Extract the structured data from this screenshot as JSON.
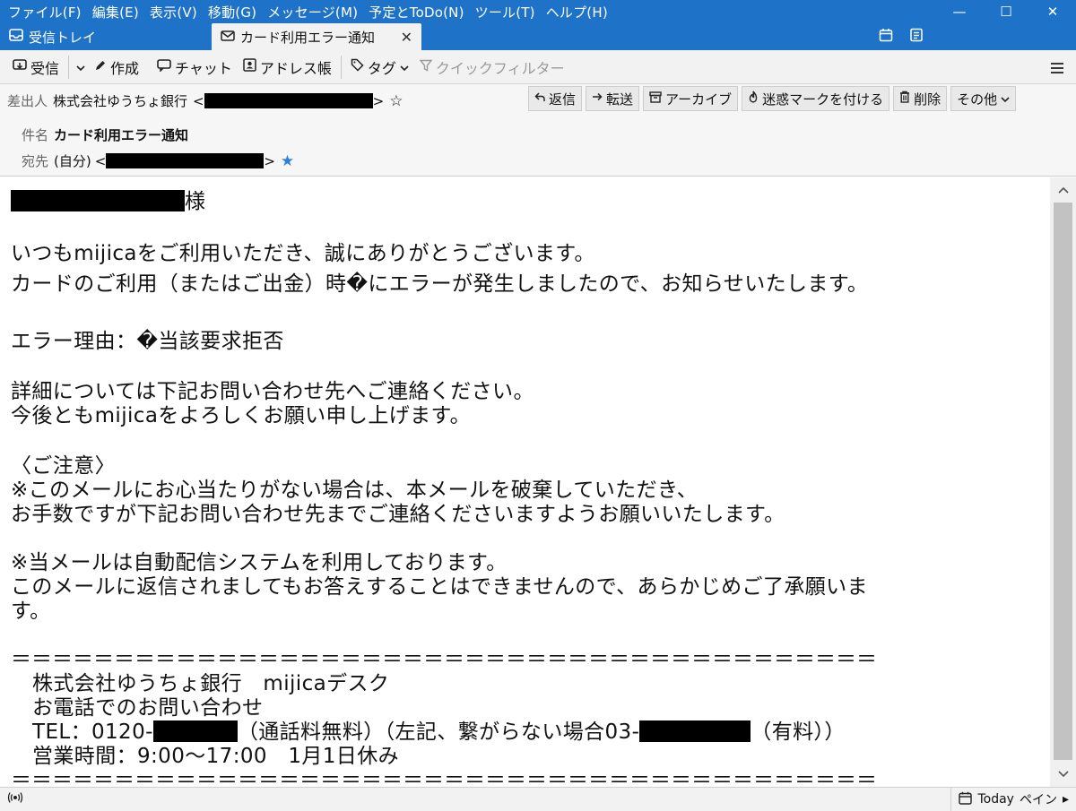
{
  "menubar": {
    "items": [
      "ファイル(F)",
      "編集(E)",
      "表示(V)",
      "移動(G)",
      "メッセージ(M)",
      "予定とToDo(N)",
      "ツール(T)",
      "ヘルプ(H)"
    ]
  },
  "window_controls": {
    "minimize": "—",
    "maximize": "☐",
    "close": "✕"
  },
  "tabs": [
    {
      "label": "受信トレイ",
      "icon": "inbox-icon"
    },
    {
      "label": "カード利用エラー通知",
      "icon": "envelope-icon",
      "close": "✕"
    }
  ],
  "tabbar_icons": [
    "calendar-icon",
    "tasks-icon"
  ],
  "toolbar": {
    "get_mail": "受信",
    "write": "作成",
    "chat": "チャット",
    "address_book": "アドレス帳",
    "tag": "タグ",
    "quick_filter": "クイックフィルター"
  },
  "header": {
    "from_label": "差出人",
    "from_name": "株式会社ゆうちょ銀行",
    "from_open": "<",
    "from_close": ">",
    "subject_label": "件名",
    "subject": "カード利用エラー通知",
    "to_label": "宛先",
    "to_value": "(自分)",
    "to_open": "<",
    "to_close": ">"
  },
  "actions": {
    "reply": "返信",
    "forward": "転送",
    "archive": "アーカイブ",
    "junk": "迷惑マークを付ける",
    "delete": "削除",
    "other": "その他"
  },
  "body": {
    "salutation_suffix": "様",
    "l1": "いつもmijicaをご利用いただき、誠にありがとうございます。",
    "l2": "カードのご利用（またはご出金）時�にエラーが発生しましたので、お知らせいたします。",
    "l3": "エラー理由：�当該要求拒否",
    "l4": "詳細については下記お問い合わせ先へご連絡ください。",
    "l5": "今後ともmijicaをよろしくお願い申し上げます。",
    "l6": "〈ご注意〉",
    "l7": "※このメールにお心当たりがない場合は、本メールを破棄していただき、",
    "l8": "お手数ですが下記お問い合わせ先までご連絡くださいますようお願いいたします。",
    "l9": "※当メールは自動配信システムを利用しております。",
    "l10": "このメールに返信されましてもお答えすることはできませんので、あらかじめご了承願いま",
    "l11": "す。",
    "divider": "＝＝＝＝＝＝＝＝＝＝＝＝＝＝＝＝＝＝＝＝＝＝＝＝＝＝＝＝＝＝＝＝＝＝＝＝＝＝＝＝＝＝",
    "sig1": "株式会社ゆうちょ銀行　mijicaデスク",
    "sig2": "お電話でのお問い合わせ",
    "sig3a": "TEL：0120-",
    "sig3b": "（通話料無料）（左記、繋がらない場合03-",
    "sig3c": "（有料））",
    "sig4": "営業時間：9:00～17:00　1月1日休み"
  },
  "statusbar": {
    "today": "Today",
    "pane": "ペイン",
    "chevron": "▸"
  }
}
